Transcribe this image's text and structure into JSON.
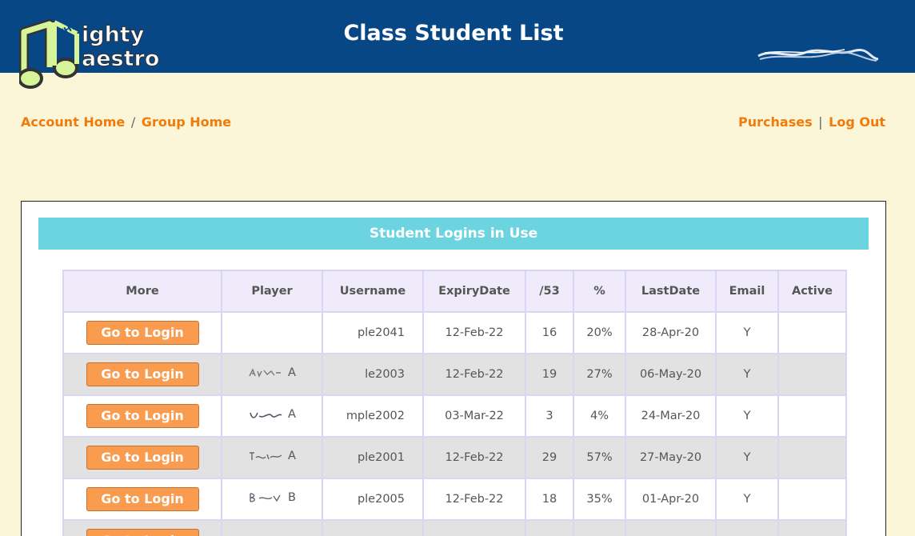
{
  "header": {
    "title": "Class Student List",
    "logo_text": "THE Mighty Maestro"
  },
  "nav": {
    "account_home": "Account Home",
    "separator": "/",
    "group_home": "Group Home",
    "purchases": "Purchases",
    "right_separator": "|",
    "log_out": "Log Out"
  },
  "section": {
    "title": "Student Logins in Use"
  },
  "table": {
    "columns": [
      "More",
      "Player",
      "Username",
      "ExpiryDate",
      "/53",
      "%",
      "LastDate",
      "Email",
      "Active"
    ],
    "rows": [
      {
        "button": "Go to Login",
        "player_initial": "",
        "username": "ple2041",
        "expiry": "12-Feb-22",
        "score": "16",
        "percent": "20%",
        "last": "28-Apr-20",
        "email": "Y",
        "active": ""
      },
      {
        "button": "Go to Login",
        "player_initial": "A",
        "username": "le2003",
        "expiry": "12-Feb-22",
        "score": "19",
        "percent": "27%",
        "last": "06-May-20",
        "email": "Y",
        "active": ""
      },
      {
        "button": "Go to Login",
        "player_initial": "A",
        "username": "mple2002",
        "expiry": "03-Mar-22",
        "score": "3",
        "percent": "4%",
        "last": "24-Mar-20",
        "email": "Y",
        "active": ""
      },
      {
        "button": "Go to Login",
        "player_initial": "A",
        "username": "ple2001",
        "expiry": "12-Feb-22",
        "score": "29",
        "percent": "57%",
        "last": "27-May-20",
        "email": "Y",
        "active": ""
      },
      {
        "button": "Go to Login",
        "player_initial": "B",
        "username": "ple2005",
        "expiry": "12-Feb-22",
        "score": "18",
        "percent": "35%",
        "last": "01-Apr-20",
        "email": "Y",
        "active": ""
      },
      {
        "button": "Go to Login",
        "player_initial": "",
        "username": "",
        "expiry": "",
        "score": "",
        "percent": "",
        "last": "",
        "email": "",
        "active": ""
      }
    ]
  },
  "colors": {
    "header_bg": "#074785",
    "page_bg": "#fcf6d8",
    "link": "#f27a0a",
    "section_bar": "#6cd4e0",
    "button": "#fa9c50"
  }
}
